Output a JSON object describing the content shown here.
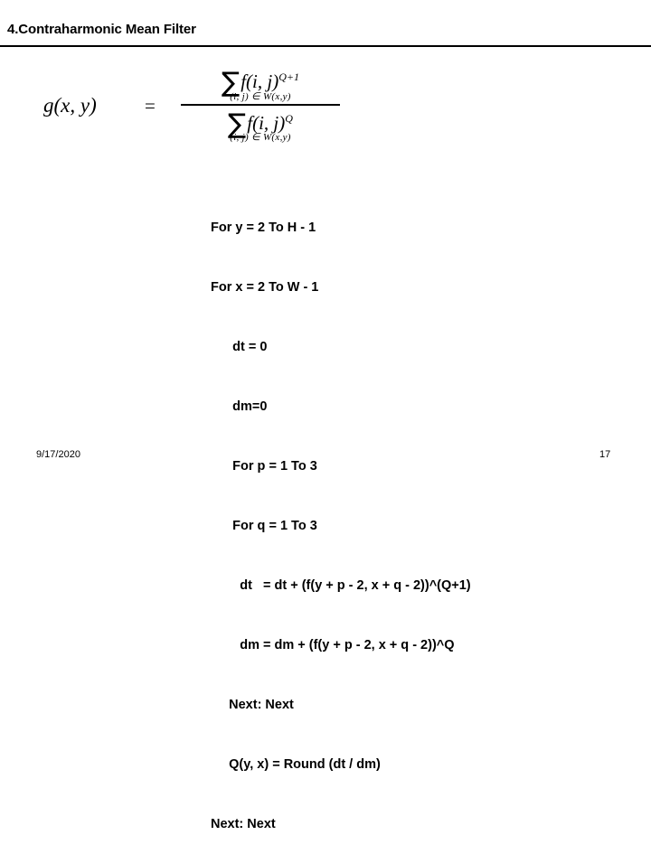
{
  "slide": {
    "title": "4.Contraharmonic Mean Filter",
    "background_color": "#ffffff",
    "text_color": "#000000",
    "rule_color": "#000000"
  },
  "formula": {
    "lhs": "g(x, y)",
    "equals": "=",
    "numerator": {
      "sum_symbol": "∑",
      "expression": "f(i, j)",
      "exponent": "Q+1",
      "condition": "(i, j) ∈ W(x,y)"
    },
    "denominator": {
      "sum_symbol": "∑",
      "expression": "f(i, j)",
      "exponent": "Q",
      "condition": "(i, j) ∈ W(x,y)"
    }
  },
  "code": {
    "lines": [
      "For y = 2 To H - 1",
      "For x = 2 To W - 1",
      "      dt = 0",
      "      dm=0",
      "      For p = 1 To 3",
      "      For q = 1 To 3",
      "        dt   = dt + (f(y + p - 2, x + q - 2))^(Q+1)",
      "        dm = dm + (f(y + p - 2, x + q - 2))^Q",
      "     Next: Next",
      "     Q(y, x) = Round (dt / dm)",
      "Next: Next"
    ]
  },
  "footer": {
    "date": "9/17/2020",
    "page_number": "17"
  }
}
